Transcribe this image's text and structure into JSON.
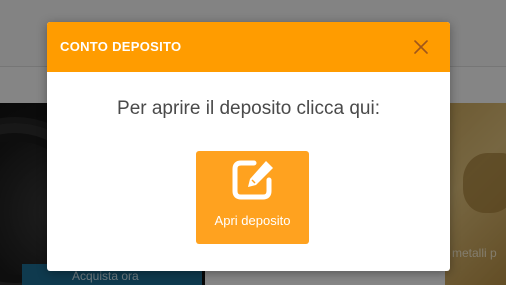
{
  "background": {
    "buy_button_label": "Acquista ora",
    "right_promo_text": "metalli p"
  },
  "modal": {
    "title": "CONTO DEPOSITO",
    "message": "Per aprire il deposito clicca qui:",
    "open_button_label": "Apri deposito",
    "open_button_icon": "edit-icon",
    "close_icon": "close-icon"
  },
  "colors": {
    "header_orange": "#ff9c00",
    "button_orange": "#ffa21f",
    "overlay": "rgba(0,0,0,0.45)"
  }
}
